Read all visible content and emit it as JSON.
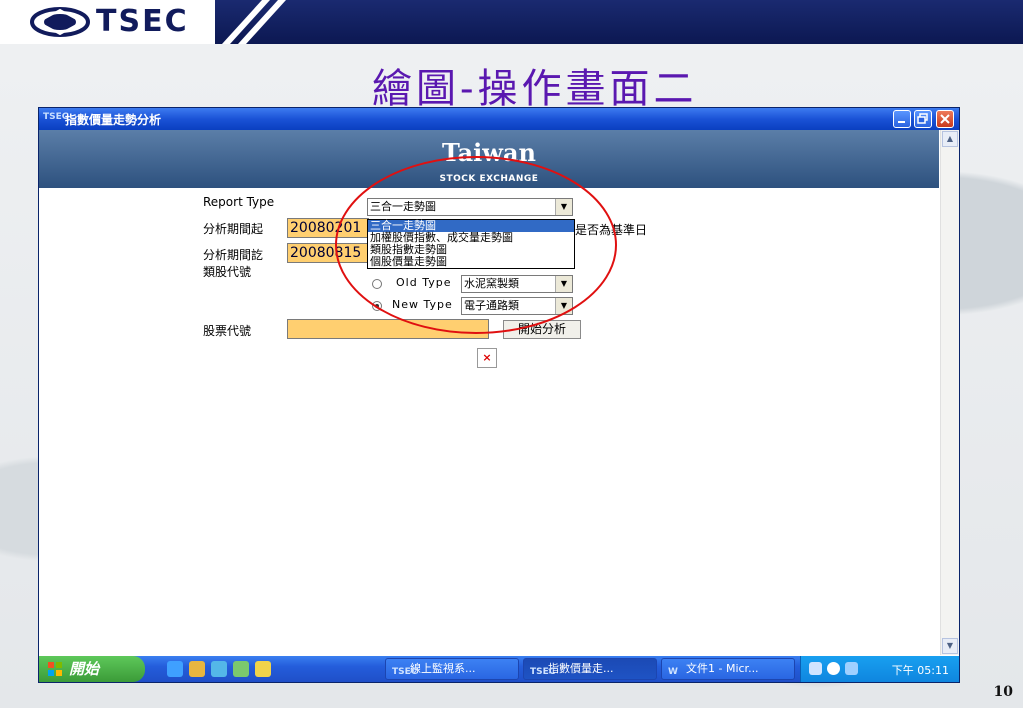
{
  "slide": {
    "logo_text": "TSEC",
    "title": "繪圖-操作畫面二",
    "page_number": "10"
  },
  "window": {
    "title": "指數價量走勢分析",
    "app_icon_text": "TSEC"
  },
  "banner": {
    "title": "Taiwan",
    "subtitle": "STOCK EXCHANGE"
  },
  "form": {
    "report_type_label": "Report Type",
    "report_type_selected": "三合一走勢圖",
    "report_type_options": [
      "三合一走勢圖",
      "加權股價指數、成交量走勢圖",
      "類股指數走勢圖",
      "個股價量走勢圖"
    ],
    "start_label": "分析期間起",
    "start_value": "20080201",
    "end_label": "分析期間訖",
    "end_value": "20080815",
    "baseline_label": "是否為基準日",
    "sector_label": "類股代號",
    "old_type_label": "Old Type",
    "old_type_value": "水泥窯製類",
    "new_type_label": "New Type",
    "new_type_value": "電子通路類",
    "stock_code_label": "股票代號",
    "stock_code_value": "",
    "analyze_button": "開始分析",
    "broken_image_glyph": "×"
  },
  "taskbar": {
    "start_label": "開始",
    "tasks": [
      {
        "label": "線上監視系...",
        "icon_text": "TSEC"
      },
      {
        "label": "指數價量走...",
        "icon_text": "TSEC"
      },
      {
        "label": "文件1 - Micr...",
        "icon_text": "W"
      }
    ],
    "clock": "下午 05:11"
  },
  "colors": {
    "title_purple": "#5a18b0",
    "field_orange": "#ffcf70",
    "annotation_red": "#e01010",
    "selection_blue": "#316ac5"
  }
}
